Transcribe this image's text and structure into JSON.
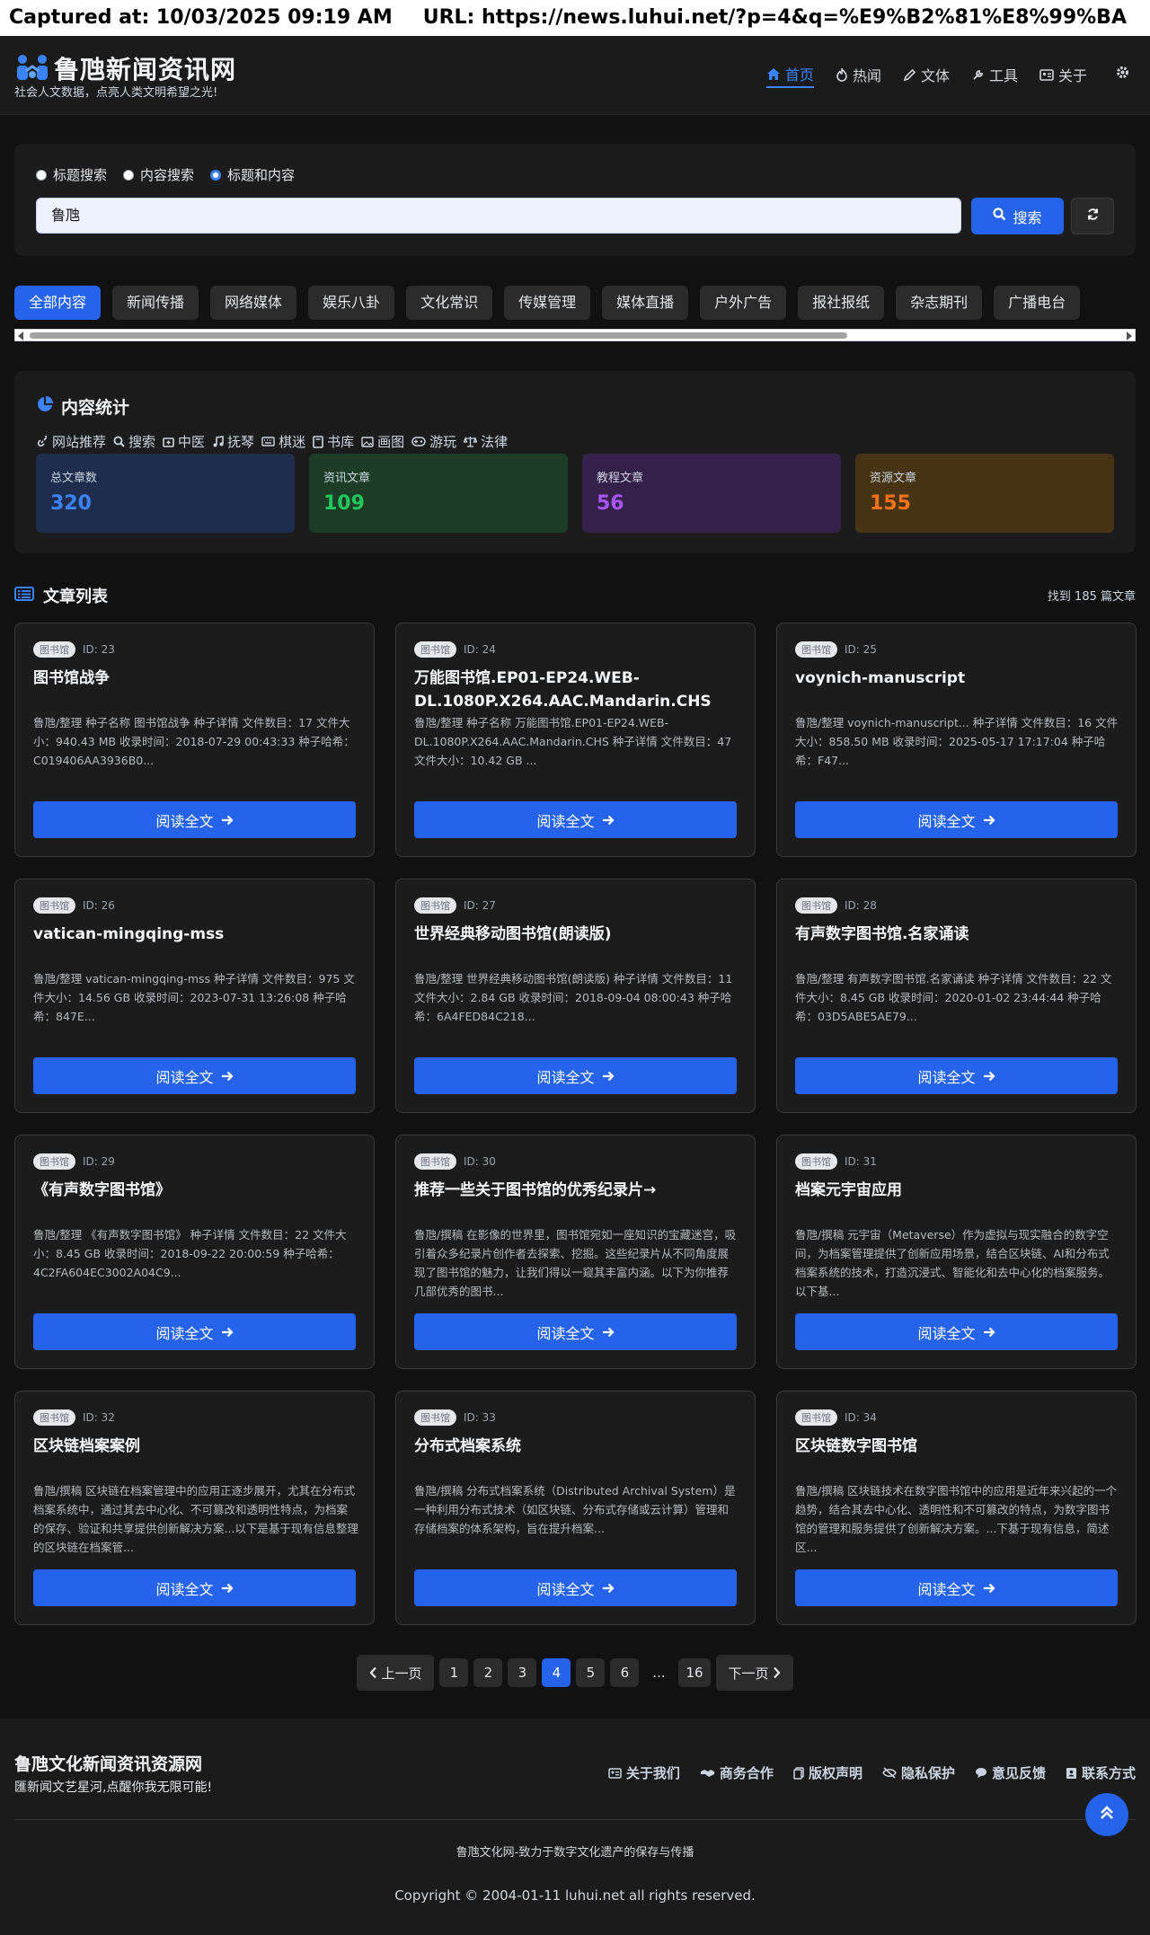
{
  "capture": {
    "captured_label": "Captured at: 10/03/2025 09:19 AM",
    "url_label": "URL: https://news.luhui.net/?p=4&q=%E9%B2%81%E8%99%BA"
  },
  "header": {
    "logo_title": "鲁虺新闻资讯网",
    "logo_subtitle": "社会人文数据，点亮人类文明希望之光!",
    "nav": [
      {
        "label": "首页",
        "icon": "home-icon",
        "active": true
      },
      {
        "label": "热闻",
        "icon": "fire-icon"
      },
      {
        "label": "文体",
        "icon": "pen-icon"
      },
      {
        "label": "工具",
        "icon": "tools-icon"
      },
      {
        "label": "关于",
        "icon": "idcard-icon"
      }
    ],
    "theme_icon": "gear-icon"
  },
  "search": {
    "options": [
      {
        "label": "标题搜索",
        "checked": false
      },
      {
        "label": "内容搜索",
        "checked": false
      },
      {
        "label": "标题和内容",
        "checked": true
      }
    ],
    "value": "鲁虺",
    "button_label": "搜索",
    "refresh_icon": "refresh-icon"
  },
  "categories": [
    "全部内容",
    "新闻传播",
    "网络媒体",
    "娱乐八卦",
    "文化常识",
    "传媒管理",
    "媒体直播",
    "户外广告",
    "报社报纸",
    "杂志期刊",
    "广播电台"
  ],
  "stats": {
    "title": "内容统计",
    "links": [
      {
        "label": "网站推荐",
        "icon": "link-icon"
      },
      {
        "label": "搜索",
        "icon": "search-icon"
      },
      {
        "label": "中医",
        "icon": "medkit-icon"
      },
      {
        "label": "抚琴",
        "icon": "music-icon"
      },
      {
        "label": "棋迷",
        "icon": "keyboard-icon"
      },
      {
        "label": "书库",
        "icon": "book-icon"
      },
      {
        "label": "画图",
        "icon": "image-icon"
      },
      {
        "label": "游玩",
        "icon": "gamepad-icon"
      },
      {
        "label": "法律",
        "icon": "scale-icon"
      }
    ],
    "cards": [
      {
        "label": "总文章数",
        "value": "320",
        "bg": "#1e2d4d",
        "color": "#3b82f6"
      },
      {
        "label": "资讯文章",
        "value": "109",
        "bg": "#1d3d27",
        "color": "#22c55e"
      },
      {
        "label": "教程文章",
        "value": "56",
        "bg": "#35204a",
        "color": "#a855f7"
      },
      {
        "label": "资源文章",
        "value": "155",
        "bg": "#463414",
        "color": "#f97316"
      }
    ]
  },
  "list": {
    "title": "文章列表",
    "found": "找到 185 篇文章",
    "read_label": "阅读全文",
    "articles": [
      {
        "badge": "图书馆",
        "id": "ID: 23",
        "title": "图书馆战争",
        "desc": "鲁虺/整理 种子名称 图书馆战争 种子详情 文件数目：17 文件大小：940.43 MB 收录时间：2018-07-29 00:43:33 种子哈希：C019406AA3936B0..."
      },
      {
        "badge": "图书馆",
        "id": "ID: 24",
        "title": "万能图书馆.EP01-EP24.WEB-DL.1080P.X264.AAC.Mandarin.CHS",
        "desc": "鲁虺/整理 种子名称 万能图书馆.EP01-EP24.WEB-DL.1080P.X264.AAC.Mandarin.CHS 种子详情 文件数目：47 文件大小：10.42 GB ..."
      },
      {
        "badge": "图书馆",
        "id": "ID: 25",
        "title": "voynich-manuscript",
        "desc": "鲁虺/整理 voynich-manuscript... 种子详情 文件数目：16 文件大小：858.50 MB 收录时间：2025-05-17 17:17:04 种子哈希：F47..."
      },
      {
        "badge": "图书馆",
        "id": "ID: 26",
        "title": "vatican-mingqing-mss",
        "desc": "鲁虺/整理 vatican-mingqing-mss 种子详情 文件数目：975 文件大小：14.56 GB 收录时间：2023-07-31 13:26:08 种子哈希：847E..."
      },
      {
        "badge": "图书馆",
        "id": "ID: 27",
        "title": "世界经典移动图书馆(朗读版)",
        "desc": "鲁虺/整理 世界经典移动图书馆(朗读版) 种子详情 文件数目：11 文件大小：2.84 GB 收录时间：2018-09-04 08:00:43 种子哈希：6A4FED84C218..."
      },
      {
        "badge": "图书馆",
        "id": "ID: 28",
        "title": "有声数字图书馆.名家诵读",
        "desc": "鲁虺/整理 有声数字图书馆.名家诵读 种子详情 文件数目：22 文件大小：8.45 GB 收录时间：2020-01-02 23:44:44 种子哈希：03D5ABE5AE79..."
      },
      {
        "badge": "图书馆",
        "id": "ID: 29",
        "title": "《有声数字图书馆》",
        "desc": "鲁虺/整理 《有声数字图书馆》 种子详情 文件数目：22 文件大小：8.45 GB 收录时间：2018-09-22 20:00:59 种子哈希：4C2FA604EC3002A04C9..."
      },
      {
        "badge": "图书馆",
        "id": "ID: 30",
        "title": "推荐一些关于图书馆的优秀纪录片→",
        "desc": "鲁虺/撰稿 在影像的世界里，图书馆宛如一座知识的宝藏迷宫，吸引着众多纪录片创作者去探索、挖掘。这些纪录片从不同角度展现了图书馆的魅力，让我们得以一窥其丰富内涵。以下为你推荐几部优秀的图书..."
      },
      {
        "badge": "图书馆",
        "id": "ID: 31",
        "title": "档案元宇宙应用",
        "desc": "鲁虺/撰稿 元宇宙（Metaverse）作为虚拟与现实融合的数字空间，为档案管理提供了创新应用场景，结合区块链、AI和分布式档案系统的技术，打造沉浸式、智能化和去中心化的档案服务。以下基..."
      },
      {
        "badge": "图书馆",
        "id": "ID: 32",
        "title": "区块链档案案例",
        "desc": "鲁虺/撰稿 区块链在档案管理中的应用正逐步展开，尤其在分布式档案系统中，通过其去中心化、不可篡改和透明性特点，为档案的保存、验证和共享提供创新解决方案...以下是基于现有信息整理的区块链在档案管..."
      },
      {
        "badge": "图书馆",
        "id": "ID: 33",
        "title": "分布式档案系统",
        "desc": "鲁虺/撰稿 分布式档案系统（Distributed Archival System）是一种利用分布式技术（如区块链、分布式存储或云计算）管理和存储档案的体系架构，旨在提升档案..."
      },
      {
        "badge": "图书馆",
        "id": "ID: 34",
        "title": "区块链数字图书馆",
        "desc": "鲁虺/撰稿 区块链技术在数字图书馆中的应用是近年来兴起的一个趋势，结合其去中心化、透明性和不可篡改的特点，为数字图书馆的管理和服务提供了创新解决方案。...下基于现有信息，简述区..."
      }
    ]
  },
  "pagination": {
    "prev": "上一页",
    "next": "下一页",
    "pages": [
      "1",
      "2",
      "3",
      "4",
      "5",
      "6",
      "...",
      "16"
    ],
    "current": "4"
  },
  "footer": {
    "brand": "鲁虺文化新闻资讯资源网",
    "slogan": "匯新闻文艺星河,点醒你我无限可能!",
    "links": [
      {
        "label": "关于我们",
        "icon": "idcard-icon"
      },
      {
        "label": "商务合作",
        "icon": "handshake-icon"
      },
      {
        "label": "版权声明",
        "icon": "copy-icon"
      },
      {
        "label": "隐私保护",
        "icon": "eye-slash-icon"
      },
      {
        "label": "意见反馈",
        "icon": "comment-icon"
      },
      {
        "label": "联系方式",
        "icon": "address-icon"
      }
    ],
    "mission": "鲁虺文化网-致力于数字文化遗产的保存与传播",
    "copyright": "Copyright © 2004-01-11 luhui.net all rights reserved."
  }
}
